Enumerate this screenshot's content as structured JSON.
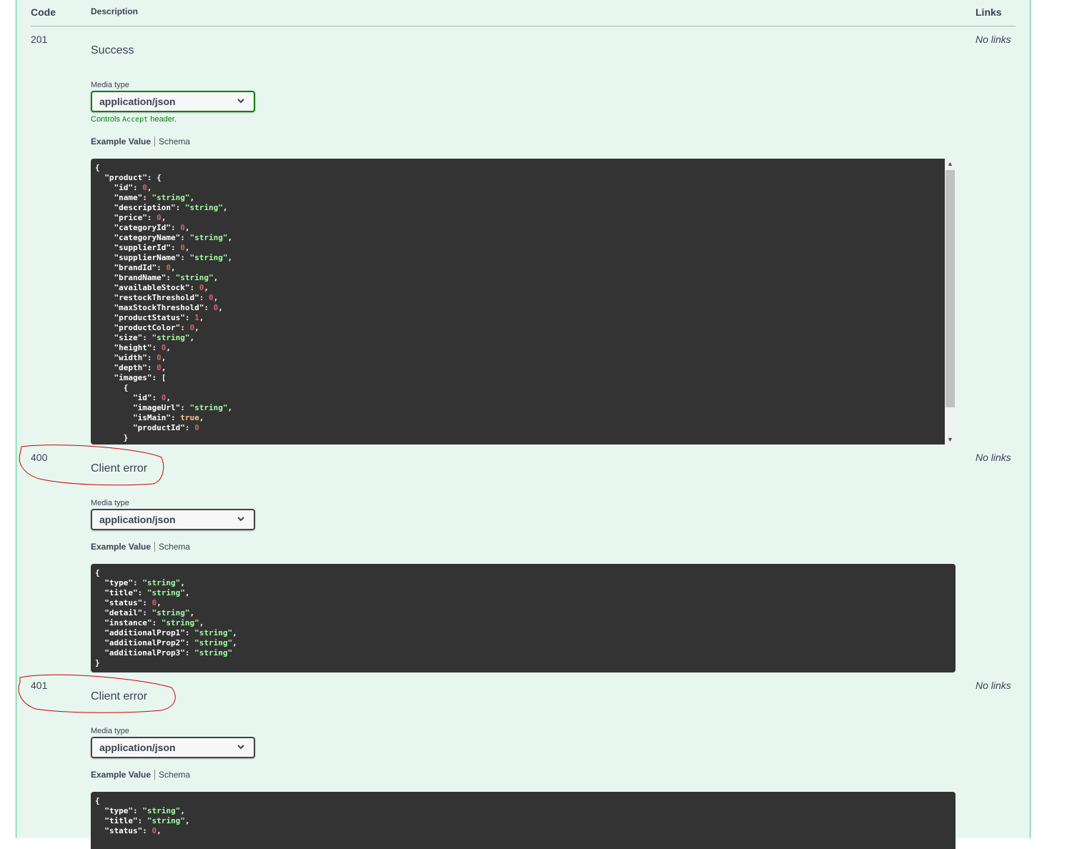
{
  "header": {
    "code": "Code",
    "description": "Description",
    "links": "Links"
  },
  "responses": [
    {
      "code": "201",
      "description": "Success",
      "links": "No links",
      "media_type_label": "Media type",
      "media_type": "application/json",
      "controls_prefix": "Controls",
      "controls_code": "Accept",
      "controls_suffix": "header.",
      "tab_example": "Example Value",
      "tab_schema": "Schema"
    },
    {
      "code": "400",
      "description": "Client error",
      "links": "No links",
      "media_type_label": "Media type",
      "media_type": "application/json",
      "tab_example": "Example Value",
      "tab_schema": "Schema"
    },
    {
      "code": "401",
      "description": "Client error",
      "links": "No links",
      "media_type_label": "Media type",
      "media_type": "application/json",
      "tab_example": "Example Value",
      "tab_schema": "Schema"
    }
  ],
  "examples": {
    "r201": [
      [
        [
          "p",
          "{"
        ]
      ],
      [
        [
          "p",
          "  "
        ],
        [
          "k",
          "\"product\""
        ],
        [
          "p",
          ": {"
        ]
      ],
      [
        [
          "p",
          "    "
        ],
        [
          "k",
          "\"id\""
        ],
        [
          "p",
          ": "
        ],
        [
          "n",
          "0"
        ],
        [
          "p",
          ","
        ]
      ],
      [
        [
          "p",
          "    "
        ],
        [
          "k",
          "\"name\""
        ],
        [
          "p",
          ": "
        ],
        [
          "s",
          "\"string\""
        ],
        [
          "p",
          ","
        ]
      ],
      [
        [
          "p",
          "    "
        ],
        [
          "k",
          "\"description\""
        ],
        [
          "p",
          ": "
        ],
        [
          "s",
          "\"string\""
        ],
        [
          "p",
          ","
        ]
      ],
      [
        [
          "p",
          "    "
        ],
        [
          "k",
          "\"price\""
        ],
        [
          "p",
          ": "
        ],
        [
          "n",
          "0"
        ],
        [
          "p",
          ","
        ]
      ],
      [
        [
          "p",
          "    "
        ],
        [
          "k",
          "\"categoryId\""
        ],
        [
          "p",
          ": "
        ],
        [
          "n",
          "0"
        ],
        [
          "p",
          ","
        ]
      ],
      [
        [
          "p",
          "    "
        ],
        [
          "k",
          "\"categoryName\""
        ],
        [
          "p",
          ": "
        ],
        [
          "s",
          "\"string\""
        ],
        [
          "p",
          ","
        ]
      ],
      [
        [
          "p",
          "    "
        ],
        [
          "k",
          "\"supplierId\""
        ],
        [
          "p",
          ": "
        ],
        [
          "n",
          "0"
        ],
        [
          "p",
          ","
        ]
      ],
      [
        [
          "p",
          "    "
        ],
        [
          "k",
          "\"supplierName\""
        ],
        [
          "p",
          ": "
        ],
        [
          "s",
          "\"string\""
        ],
        [
          "p",
          ","
        ]
      ],
      [
        [
          "p",
          "    "
        ],
        [
          "k",
          "\"brandId\""
        ],
        [
          "p",
          ": "
        ],
        [
          "n",
          "0"
        ],
        [
          "p",
          ","
        ]
      ],
      [
        [
          "p",
          "    "
        ],
        [
          "k",
          "\"brandName\""
        ],
        [
          "p",
          ": "
        ],
        [
          "s",
          "\"string\""
        ],
        [
          "p",
          ","
        ]
      ],
      [
        [
          "p",
          "    "
        ],
        [
          "k",
          "\"availableStock\""
        ],
        [
          "p",
          ": "
        ],
        [
          "n",
          "0"
        ],
        [
          "p",
          ","
        ]
      ],
      [
        [
          "p",
          "    "
        ],
        [
          "k",
          "\"restockThreshold\""
        ],
        [
          "p",
          ": "
        ],
        [
          "n",
          "0"
        ],
        [
          "p",
          ","
        ]
      ],
      [
        [
          "p",
          "    "
        ],
        [
          "k",
          "\"maxStockThreshold\""
        ],
        [
          "p",
          ": "
        ],
        [
          "n",
          "0"
        ],
        [
          "p",
          ","
        ]
      ],
      [
        [
          "p",
          "    "
        ],
        [
          "k",
          "\"productStatus\""
        ],
        [
          "p",
          ": "
        ],
        [
          "n",
          "1"
        ],
        [
          "p",
          ","
        ]
      ],
      [
        [
          "p",
          "    "
        ],
        [
          "k",
          "\"productColor\""
        ],
        [
          "p",
          ": "
        ],
        [
          "n",
          "0"
        ],
        [
          "p",
          ","
        ]
      ],
      [
        [
          "p",
          "    "
        ],
        [
          "k",
          "\"size\""
        ],
        [
          "p",
          ": "
        ],
        [
          "s",
          "\"string\""
        ],
        [
          "p",
          ","
        ]
      ],
      [
        [
          "p",
          "    "
        ],
        [
          "k",
          "\"height\""
        ],
        [
          "p",
          ": "
        ],
        [
          "n",
          "0"
        ],
        [
          "p",
          ","
        ]
      ],
      [
        [
          "p",
          "    "
        ],
        [
          "k",
          "\"width\""
        ],
        [
          "p",
          ": "
        ],
        [
          "n",
          "0"
        ],
        [
          "p",
          ","
        ]
      ],
      [
        [
          "p",
          "    "
        ],
        [
          "k",
          "\"depth\""
        ],
        [
          "p",
          ": "
        ],
        [
          "n",
          "0"
        ],
        [
          "p",
          ","
        ]
      ],
      [
        [
          "p",
          "    "
        ],
        [
          "k",
          "\"images\""
        ],
        [
          "p",
          ": ["
        ]
      ],
      [
        [
          "p",
          "      {"
        ]
      ],
      [
        [
          "p",
          "        "
        ],
        [
          "k",
          "\"id\""
        ],
        [
          "p",
          ": "
        ],
        [
          "n",
          "0"
        ],
        [
          "p",
          ","
        ]
      ],
      [
        [
          "p",
          "        "
        ],
        [
          "k",
          "\"imageUrl\""
        ],
        [
          "p",
          ": "
        ],
        [
          "s",
          "\"string\""
        ],
        [
          "p",
          ","
        ]
      ],
      [
        [
          "p",
          "        "
        ],
        [
          "k",
          "\"isMain\""
        ],
        [
          "p",
          ": "
        ],
        [
          "b",
          "true"
        ],
        [
          "p",
          ","
        ]
      ],
      [
        [
          "p",
          "        "
        ],
        [
          "k",
          "\"productId\""
        ],
        [
          "p",
          ": "
        ],
        [
          "n",
          "0"
        ]
      ],
      [
        [
          "p",
          "      }"
        ]
      ]
    ],
    "r400": [
      [
        [
          "p",
          "{"
        ]
      ],
      [
        [
          "p",
          "  "
        ],
        [
          "k",
          "\"type\""
        ],
        [
          "p",
          ": "
        ],
        [
          "s",
          "\"string\""
        ],
        [
          "p",
          ","
        ]
      ],
      [
        [
          "p",
          "  "
        ],
        [
          "k",
          "\"title\""
        ],
        [
          "p",
          ": "
        ],
        [
          "s",
          "\"string\""
        ],
        [
          "p",
          ","
        ]
      ],
      [
        [
          "p",
          "  "
        ],
        [
          "k",
          "\"status\""
        ],
        [
          "p",
          ": "
        ],
        [
          "n",
          "0"
        ],
        [
          "p",
          ","
        ]
      ],
      [
        [
          "p",
          "  "
        ],
        [
          "k",
          "\"detail\""
        ],
        [
          "p",
          ": "
        ],
        [
          "s",
          "\"string\""
        ],
        [
          "p",
          ","
        ]
      ],
      [
        [
          "p",
          "  "
        ],
        [
          "k",
          "\"instance\""
        ],
        [
          "p",
          ": "
        ],
        [
          "s",
          "\"string\""
        ],
        [
          "p",
          ","
        ]
      ],
      [
        [
          "p",
          "  "
        ],
        [
          "k",
          "\"additionalProp1\""
        ],
        [
          "p",
          ": "
        ],
        [
          "s",
          "\"string\""
        ],
        [
          "p",
          ","
        ]
      ],
      [
        [
          "p",
          "  "
        ],
        [
          "k",
          "\"additionalProp2\""
        ],
        [
          "p",
          ": "
        ],
        [
          "s",
          "\"string\""
        ],
        [
          "p",
          ","
        ]
      ],
      [
        [
          "p",
          "  "
        ],
        [
          "k",
          "\"additionalProp3\""
        ],
        [
          "p",
          ": "
        ],
        [
          "s",
          "\"string\""
        ]
      ],
      [
        [
          "p",
          "}"
        ]
      ]
    ],
    "r401": [
      [
        [
          "p",
          "{"
        ]
      ],
      [
        [
          "p",
          "  "
        ],
        [
          "k",
          "\"type\""
        ],
        [
          "p",
          ": "
        ],
        [
          "s",
          "\"string\""
        ],
        [
          "p",
          ","
        ]
      ],
      [
        [
          "p",
          "  "
        ],
        [
          "k",
          "\"title\""
        ],
        [
          "p",
          ": "
        ],
        [
          "s",
          "\"string\""
        ],
        [
          "p",
          ","
        ]
      ],
      [
        [
          "p",
          "  "
        ],
        [
          "k",
          "\"status\""
        ],
        [
          "p",
          ": "
        ],
        [
          "n",
          "0"
        ],
        [
          "p",
          ","
        ]
      ]
    ]
  },
  "colors": {
    "panel_bg": "#e8f6f0",
    "panel_border": "#49cc90",
    "active_select": "#008000",
    "code_bg": "#333333",
    "annotation": "#cc0000"
  },
  "icons": {
    "select_arrow": "chevron-down-icon"
  }
}
